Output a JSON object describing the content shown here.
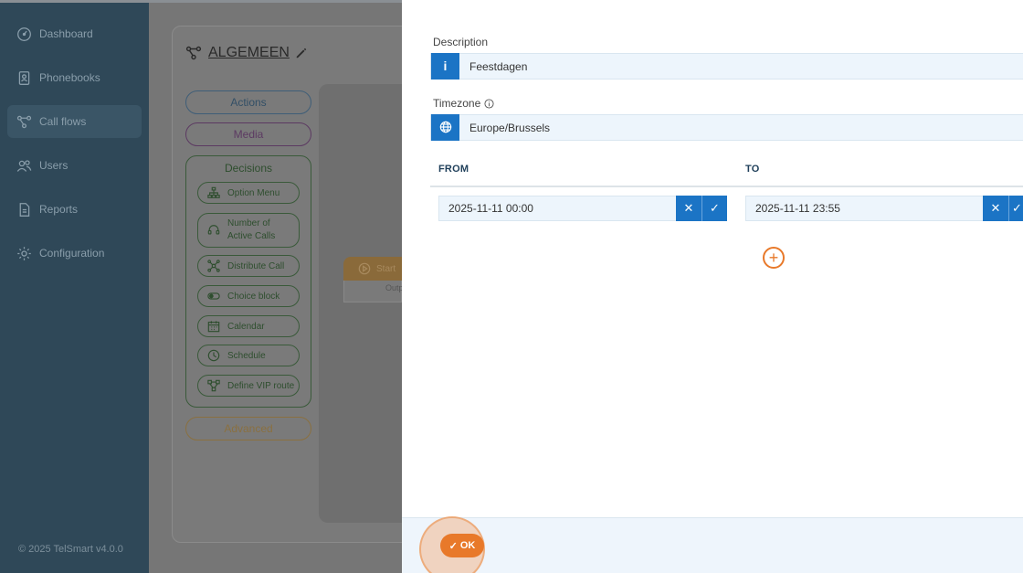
{
  "sidebar": {
    "items": [
      {
        "label": "Dashboard",
        "icon": "gauge-icon"
      },
      {
        "label": "Phonebooks",
        "icon": "phonebook-icon"
      },
      {
        "label": "Call flows",
        "icon": "flow-icon",
        "active": true
      },
      {
        "label": "Users",
        "icon": "users-icon"
      },
      {
        "label": "Reports",
        "icon": "report-icon"
      },
      {
        "label": "Configuration",
        "icon": "gear-icon"
      }
    ],
    "footer": "© 2025 TelSmart  v4.0.0"
  },
  "flow": {
    "title": "ALGEMEEN",
    "actions_label": "Actions",
    "media_label": "Media",
    "decisions_label": "Decisions",
    "decision_items": [
      "Option Menu",
      "Number of Active Calls",
      "Distribute Call",
      "Choice block",
      "Calendar",
      "Schedule",
      "Define VIP route"
    ],
    "advanced_label": "Advanced",
    "start_label": "Start",
    "output_label": "Outp"
  },
  "dialog": {
    "description_label": "Description",
    "description_value": "Feestdagen",
    "timezone_label": "Timezone",
    "timezone_value": "Europe/Brussels",
    "from_header": "FROM",
    "to_header": "TO",
    "from_value": "2025-11-11 00:00",
    "to_value": "2025-11-11 23:55",
    "ok_label": "OK"
  },
  "colors": {
    "sidebar": "#2f4858",
    "primary": "#1b74c5",
    "accent": "#e8792a"
  }
}
